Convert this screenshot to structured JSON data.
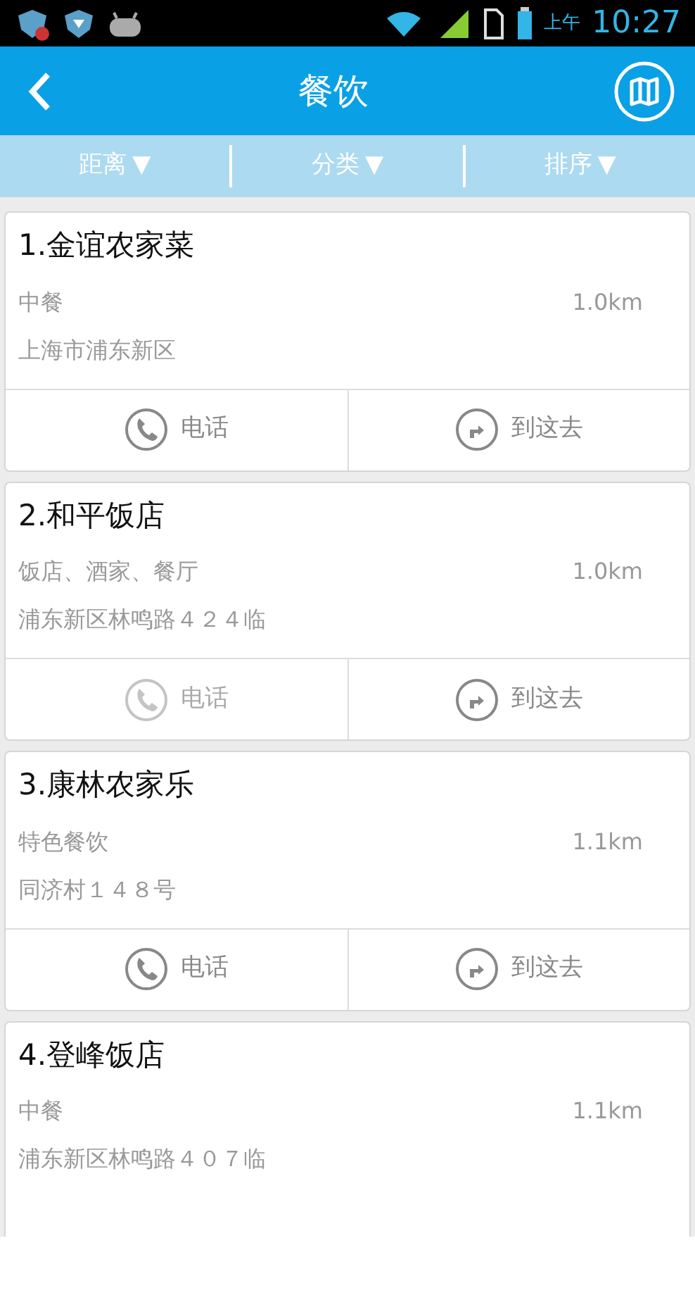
{
  "status_bar": {
    "ampm": "上午",
    "time": "10:27"
  },
  "header": {
    "title": "餐饮"
  },
  "filters": [
    {
      "label": "距离",
      "arrow": "▼"
    },
    {
      "label": "分类",
      "arrow": "▼"
    },
    {
      "label": "排序",
      "arrow": "▼"
    }
  ],
  "places": [
    {
      "title": "1.金谊农家菜",
      "category": "中餐",
      "distance": "1.0km",
      "address": "上海市浦东新区",
      "actions": [
        {
          "kind": "phone",
          "label": "电话",
          "disabled": false
        },
        {
          "kind": "route",
          "label": "到这去",
          "disabled": false
        }
      ]
    },
    {
      "title": "2.和平饭店",
      "category": "饭店、酒家、餐厅",
      "distance": "1.0km",
      "address": "浦东新区林鸣路４２４临",
      "actions": [
        {
          "kind": "phone",
          "label": "电话",
          "disabled": true
        },
        {
          "kind": "route",
          "label": "到这去",
          "disabled": false
        }
      ]
    },
    {
      "title": "3.康林农家乐",
      "category": "特色餐饮",
      "distance": "1.1km",
      "address": "同济村１４８号",
      "actions": [
        {
          "kind": "phone",
          "label": "电话",
          "disabled": false
        },
        {
          "kind": "route",
          "label": "到这去",
          "disabled": false
        }
      ]
    },
    {
      "title": "4.登峰饭店",
      "category": "中餐",
      "distance": "1.1km",
      "address": "浦东新区林鸣路４０７临"
    }
  ]
}
